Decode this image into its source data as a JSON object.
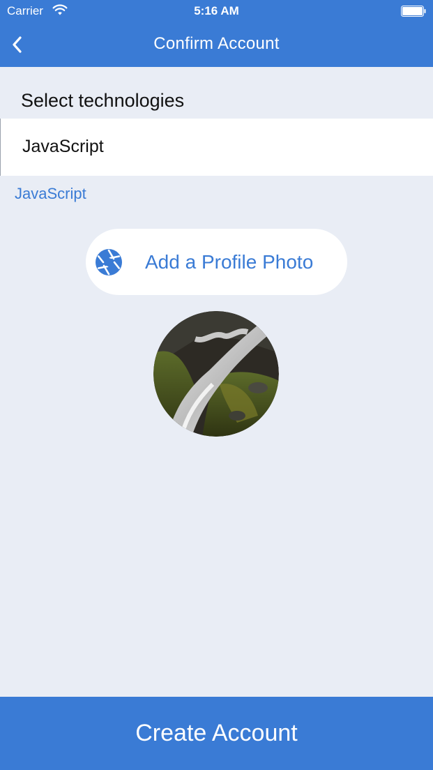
{
  "status_bar": {
    "carrier": "Carrier",
    "time": "5:16 AM",
    "wifi_icon": "wifi-icon",
    "battery_icon": "battery-icon"
  },
  "nav": {
    "title": "Confirm Account",
    "back_icon": "chevron-left-icon"
  },
  "form": {
    "section_label": "Select technologies",
    "select_value": "JavaScript",
    "selected_tag": "JavaScript"
  },
  "profile_photo": {
    "button_label": "Add a Profile Photo",
    "button_icon": "camera-aperture-icon"
  },
  "footer": {
    "create_label": "Create Account"
  },
  "colors": {
    "accent": "#3A7BD5",
    "background": "#E9EDF5",
    "surface": "#FFFFFF"
  }
}
